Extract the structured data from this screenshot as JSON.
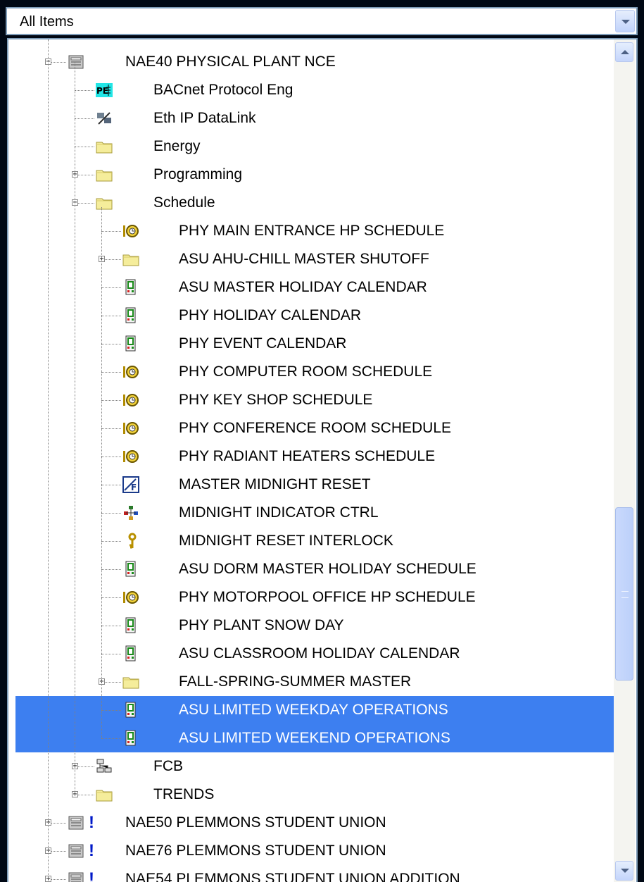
{
  "dropdown": {
    "value": "All Items"
  },
  "tree": {
    "rows": [
      {
        "label": "NAE40 PHYSICAL PLANT NCE",
        "icon": "server-icon",
        "level": 0,
        "expander": "minus",
        "warn": false
      },
      {
        "label": "BACnet Protocol Eng",
        "icon": "protocol-engine-icon",
        "level": 1,
        "expander": "",
        "warn": false
      },
      {
        "label": "Eth IP DataLink",
        "icon": "datalink-icon",
        "level": 1,
        "expander": "",
        "warn": false
      },
      {
        "label": "Energy",
        "icon": "folder-icon",
        "level": 1,
        "expander": "",
        "warn": false
      },
      {
        "label": "Programming",
        "icon": "folder-icon",
        "level": 1,
        "expander": "plus",
        "warn": false
      },
      {
        "label": "Schedule",
        "icon": "folder-icon",
        "level": 1,
        "expander": "minus",
        "warn": false
      },
      {
        "label": "PHY MAIN ENTRANCE HP SCHEDULE",
        "icon": "schedule-icon",
        "level": 2,
        "expander": "",
        "warn": false
      },
      {
        "label": "ASU AHU-CHILL MASTER SHUTOFF",
        "icon": "folder-icon",
        "level": 2,
        "expander": "plus",
        "warn": false
      },
      {
        "label": "ASU MASTER HOLIDAY CALENDAR",
        "icon": "calendar-icon",
        "level": 2,
        "expander": "",
        "warn": false
      },
      {
        "label": "PHY HOLIDAY CALENDAR",
        "icon": "calendar-icon",
        "level": 2,
        "expander": "",
        "warn": false
      },
      {
        "label": "PHY EVENT CALENDAR",
        "icon": "calendar-icon",
        "level": 2,
        "expander": "",
        "warn": false
      },
      {
        "label": "PHY COMPUTER ROOM SCHEDULE",
        "icon": "schedule-icon",
        "level": 2,
        "expander": "",
        "warn": false
      },
      {
        "label": "PHY KEY SHOP SCHEDULE",
        "icon": "schedule-icon",
        "level": 2,
        "expander": "",
        "warn": false
      },
      {
        "label": "PHY CONFERENCE ROOM SCHEDULE",
        "icon": "schedule-icon",
        "level": 2,
        "expander": "",
        "warn": false
      },
      {
        "label": "PHY RADIANT HEATERS SCHEDULE",
        "icon": "schedule-icon",
        "level": 2,
        "expander": "",
        "warn": false
      },
      {
        "label": "MASTER MIDNIGHT RESET",
        "icon": "logic-icon",
        "level": 2,
        "expander": "",
        "warn": false
      },
      {
        "label": "MIDNIGHT INDICATOR CTRL",
        "icon": "network-icon",
        "level": 2,
        "expander": "",
        "warn": false
      },
      {
        "label": "MIDNIGHT RESET INTERLOCK",
        "icon": "key-icon",
        "level": 2,
        "expander": "",
        "warn": false
      },
      {
        "label": "ASU DORM MASTER HOLIDAY SCHEDULE",
        "icon": "calendar-icon",
        "level": 2,
        "expander": "",
        "warn": false
      },
      {
        "label": "PHY MOTORPOOL OFFICE HP SCHEDULE",
        "icon": "schedule-icon",
        "level": 2,
        "expander": "",
        "warn": false
      },
      {
        "label": "PHY PLANT SNOW DAY",
        "icon": "calendar-icon",
        "level": 2,
        "expander": "",
        "warn": false
      },
      {
        "label": "ASU CLASSROOM HOLIDAY CALENDAR",
        "icon": "calendar-icon",
        "level": 2,
        "expander": "",
        "warn": false
      },
      {
        "label": "FALL-SPRING-SUMMER MASTER",
        "icon": "folder-icon",
        "level": 2,
        "expander": "plus",
        "warn": false
      },
      {
        "label": "ASU LIMITED WEEKDAY OPERATIONS",
        "icon": "calendar-icon",
        "level": 2,
        "expander": "",
        "warn": false,
        "selected": true
      },
      {
        "label": "ASU LIMITED WEEKEND OPERATIONS",
        "icon": "calendar-icon",
        "level": 2,
        "expander": "",
        "warn": false,
        "selected": true
      },
      {
        "label": "FCB",
        "icon": "field-bus-icon",
        "level": 1,
        "expander": "plus",
        "warn": false
      },
      {
        "label": "TRENDS",
        "icon": "folder-icon",
        "level": 1,
        "expander": "plus",
        "warn": false
      },
      {
        "label": "NAE50 PLEMMONS STUDENT UNION",
        "icon": "server-icon",
        "level": 0,
        "expander": "plus",
        "warn": true
      },
      {
        "label": "NAE76 PLEMMONS STUDENT UNION",
        "icon": "server-icon",
        "level": 0,
        "expander": "plus",
        "warn": true
      },
      {
        "label": "NAE54 PLEMMONS STUDENT UNION ADDITION",
        "icon": "server-icon",
        "level": 0,
        "expander": "plus",
        "warn": true
      }
    ],
    "warn_glyph": "!"
  }
}
